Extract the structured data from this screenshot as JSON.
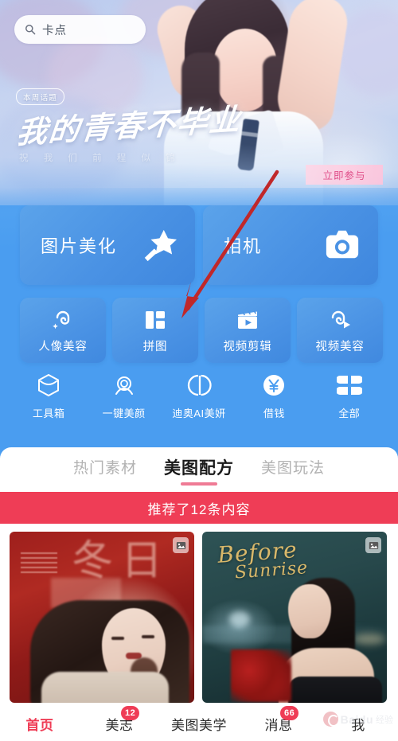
{
  "search": {
    "value": "卡点",
    "icon": "search-icon"
  },
  "hero": {
    "topic_tag": "本周话题",
    "topic_title": "我的青春不毕业",
    "topic_subtitle": "祝 我 们 前 程 似 锦",
    "join_button": "立即参与"
  },
  "big_features": [
    {
      "label": "图片美化",
      "icon": "magic-wand-star-icon"
    },
    {
      "label": "相机",
      "icon": "camera-icon"
    }
  ],
  "small_features": [
    {
      "label": "人像美容",
      "icon": "portrait-beauty-icon"
    },
    {
      "label": "拼图",
      "icon": "collage-grid-icon"
    },
    {
      "label": "视频剪辑",
      "icon": "clapperboard-play-icon"
    },
    {
      "label": "视频美容",
      "icon": "video-beauty-icon"
    }
  ],
  "quick_icons": [
    {
      "label": "工具箱",
      "icon": "toolbox-hexagon-icon"
    },
    {
      "label": "一键美颜",
      "icon": "face-beauty-icon"
    },
    {
      "label": "迪奥AI美妍",
      "icon": "dior-cd-logo-icon"
    },
    {
      "label": "借钱",
      "icon": "yuan-coin-icon"
    },
    {
      "label": "全部",
      "icon": "grid-all-icon"
    }
  ],
  "tabs": [
    {
      "label": "热门素材",
      "active": false
    },
    {
      "label": "美图配方",
      "active": true
    },
    {
      "label": "美图玩法",
      "active": false
    }
  ],
  "recommend_bar": {
    "text": "推荐了12条内容",
    "count": 12
  },
  "feed_cards": [
    {
      "title": "冬日",
      "badge_icon": "multi-image-icon"
    },
    {
      "title": "Before",
      "title_line2": "Sunrise",
      "badge_icon": "multi-image-icon"
    }
  ],
  "bottom_nav": [
    {
      "label": "首页",
      "active": true,
      "badge": ""
    },
    {
      "label": "美志",
      "active": false,
      "badge": "12"
    },
    {
      "label": "美图美学",
      "active": false,
      "badge": ""
    },
    {
      "label": "消息",
      "active": false,
      "badge": "66"
    },
    {
      "label": "我",
      "active": false,
      "badge": ""
    }
  ],
  "watermark": {
    "text": "Baidu",
    "text2": "经验"
  },
  "annotation": {
    "type": "arrow",
    "color": "#c0282a",
    "points_to": "拼图"
  },
  "colors": {
    "background_blue": "#4a9df0",
    "card_blue": "#4a92e4",
    "accent_red": "#ef3d56",
    "tab_underline": "#ef7b95",
    "join_text": "#e0508a"
  }
}
